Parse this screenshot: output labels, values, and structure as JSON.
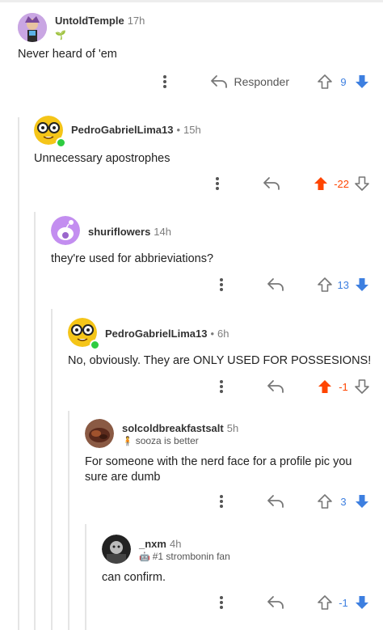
{
  "colors": {
    "upvote_active": "#ff4500",
    "downvote_active": "#3d7fe0",
    "score_up": "#ff4500",
    "score_down": "#3d7fe0",
    "icon_gray": "#777777"
  },
  "comments": [
    {
      "username": "UntoldTemple",
      "age": "17h",
      "separator": "",
      "flair": "",
      "flair_icon": "plant-icon",
      "body": "Never heard of 'em",
      "reply_label": "Responder",
      "score": "9",
      "vote": "down"
    },
    {
      "username": "PedroGabrielLima13",
      "age": "15h",
      "separator": "•",
      "flair": "",
      "body": "Unnecessary apostrophes",
      "reply_label": "",
      "score": "-22",
      "vote": "up"
    },
    {
      "username": "shuriflowers",
      "age": "14h",
      "separator": "",
      "flair": "",
      "body": "they're used for abbrieviations?",
      "reply_label": "",
      "score": "13",
      "vote": "down"
    },
    {
      "username": "PedroGabrielLima13",
      "age": "6h",
      "separator": "•",
      "flair": "",
      "body": "No, obviously. They are ONLY USED FOR POSSESIONS!",
      "reply_label": "",
      "score": "-1",
      "vote": "up"
    },
    {
      "username": "solcoldbreakfastsalt",
      "age": "5h",
      "separator": "",
      "flair": "sooza is better",
      "flair_icon": "person-icon",
      "body": "For someone with the nerd face for a profile pic you sure are dumb",
      "reply_label": "",
      "score": "3",
      "vote": "down"
    },
    {
      "username": "_nxm",
      "age": "4h",
      "separator": "",
      "flair": "#1 strombonin fan",
      "flair_icon": "robot-icon",
      "body": "can confirm.",
      "reply_label": "",
      "score": "-1",
      "vote": "down"
    }
  ]
}
